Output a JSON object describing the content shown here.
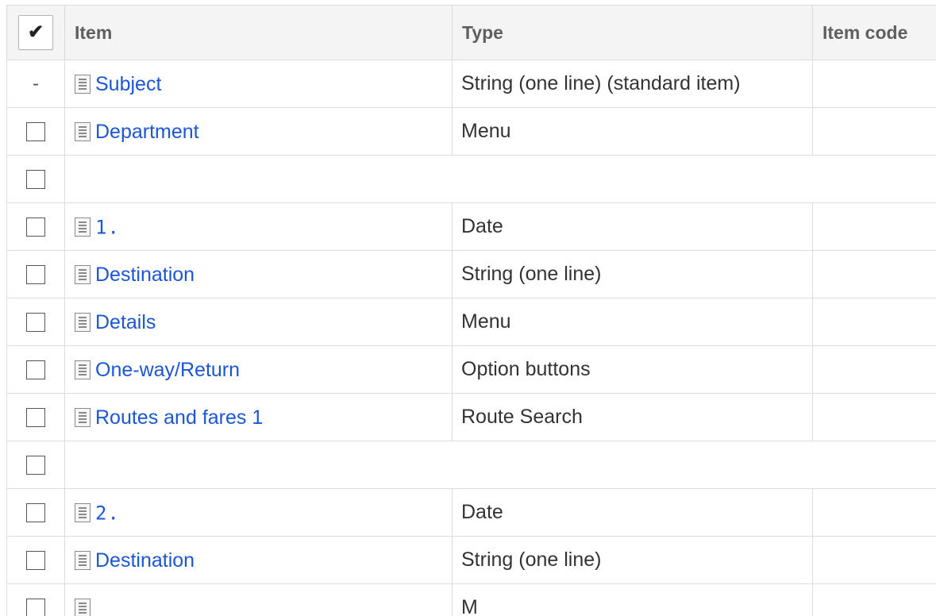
{
  "header": {
    "check_symbol": "✔",
    "item_label": "Item",
    "type_label": "Type",
    "code_label": "Item code"
  },
  "rows": [
    {
      "check": "dash",
      "dash_text": "-",
      "item": "Subject",
      "type": "String (one line) (standard item)",
      "code": ""
    },
    {
      "check": "box",
      "item": "Department",
      "type": "Menu",
      "code": ""
    },
    {
      "check": "box",
      "blank": true
    },
    {
      "check": "box",
      "item": "1.",
      "type": "Date",
      "code": "",
      "numbered": true
    },
    {
      "check": "box",
      "item": "Destination",
      "type": "String (one line)",
      "code": ""
    },
    {
      "check": "box",
      "item": "Details",
      "type": "Menu",
      "code": ""
    },
    {
      "check": "box",
      "item": "One-way/Return",
      "type": "Option buttons",
      "code": ""
    },
    {
      "check": "box",
      "item": "Routes and fares 1",
      "type": "Route Search",
      "code": ""
    },
    {
      "check": "box",
      "blank": true
    },
    {
      "check": "box",
      "item": "2.",
      "type": "Date",
      "code": "",
      "numbered": true
    },
    {
      "check": "box",
      "item": "Destination",
      "type": "String (one line)",
      "code": ""
    },
    {
      "check": "box",
      "item": "",
      "type": "M",
      "code": ""
    }
  ]
}
